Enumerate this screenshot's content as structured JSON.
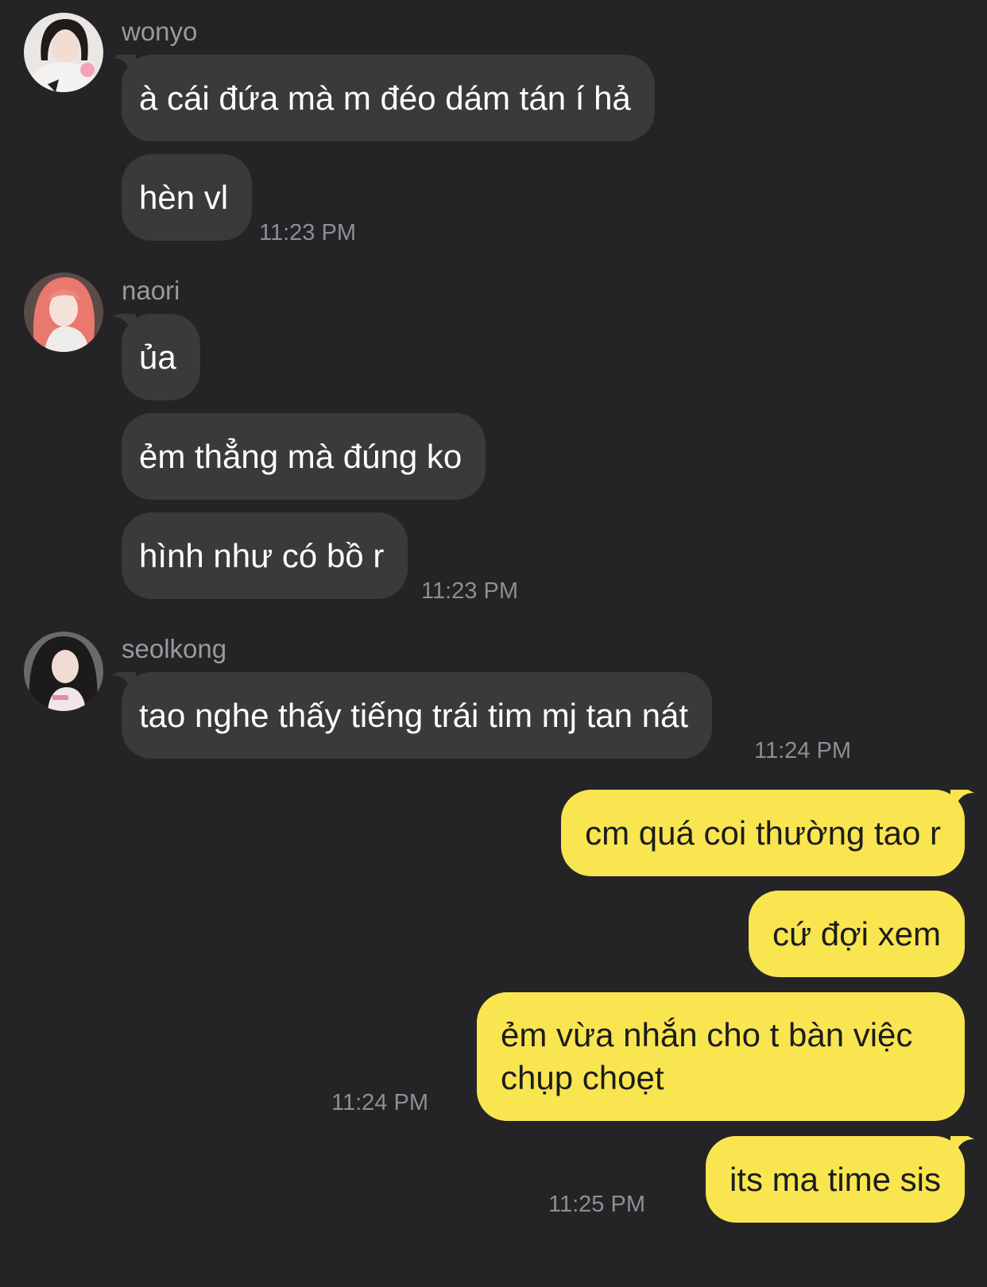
{
  "colors": {
    "background": "#242426",
    "incoming_bubble": "#3a3a3c",
    "outgoing_bubble": "#f9e550",
    "sender_name": "#9a9a9e",
    "timestamp": "#8e8e93"
  },
  "groups": [
    {
      "sender": "wonyo",
      "avatar": "avatar-photo",
      "messages": [
        "à cái đứa mà m đéo dám tán í hả",
        "hèn vl"
      ],
      "time": "11:23 PM"
    },
    {
      "sender": "naori",
      "avatar": "avatar-photo",
      "messages": [
        "ủa",
        "ẻm thẳng mà đúng ko",
        "hình như có bồ r"
      ],
      "time": "11:23 PM"
    },
    {
      "sender": "seolkong",
      "avatar": "avatar-photo",
      "messages": [
        "tao nghe thấy tiếng trái tim mj tan nát"
      ],
      "time": "11:24 PM"
    }
  ],
  "outgoing": [
    {
      "messages": [
        "cm quá coi thường tao r",
        "cứ đợi xem",
        "ẻm vừa nhắn cho t bàn việc chụp choẹt"
      ],
      "time": "11:24 PM"
    },
    {
      "messages": [
        "its ma time sis"
      ],
      "time": "11:25 PM"
    }
  ]
}
